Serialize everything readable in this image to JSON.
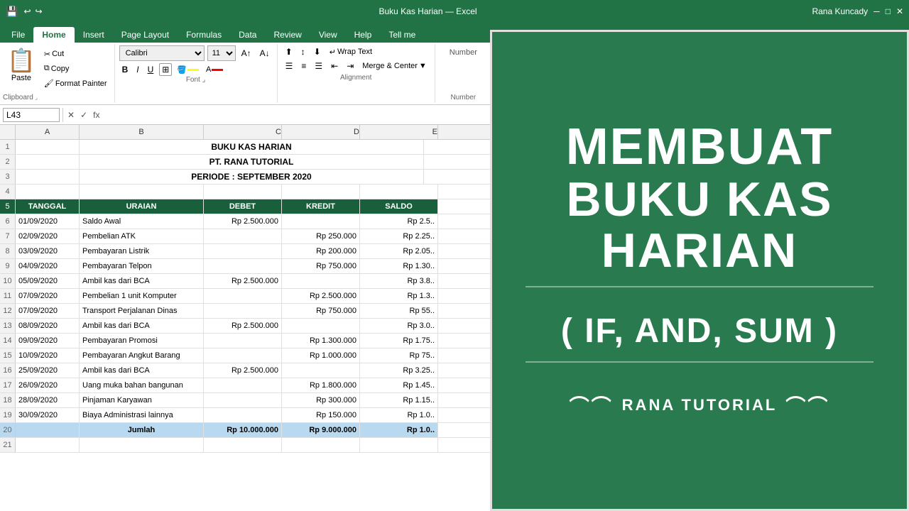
{
  "titlebar": {
    "title": "Buku Kas Harian — Excel",
    "user": "Rana Kuncady"
  },
  "ribbon": {
    "tabs": [
      "File",
      "Home",
      "Insert",
      "Page Layout",
      "Formulas",
      "Data",
      "Review",
      "View",
      "Help",
      "Tell me"
    ],
    "active_tab": "Home",
    "clipboard": {
      "paste_label": "Paste",
      "cut_label": "Cut",
      "copy_label": "Copy",
      "format_painter_label": "Format Painter"
    },
    "font": {
      "family": "Calibri",
      "size": "11",
      "bold": "B",
      "italic": "I",
      "underline": "U"
    },
    "alignment": {
      "wrap_text": "Wrap Text",
      "merge_center": "Merge & Center"
    }
  },
  "formula_bar": {
    "cell_ref": "L43",
    "formula": ""
  },
  "columns": [
    "A",
    "B",
    "C",
    "D",
    "E"
  ],
  "spreadsheet": {
    "rows": [
      {
        "num": "1",
        "cells": [
          "",
          "BUKU KAS HARIAN",
          "",
          "",
          ""
        ]
      },
      {
        "num": "2",
        "cells": [
          "",
          "PT. RANA TUTORIAL",
          "",
          "",
          ""
        ]
      },
      {
        "num": "3",
        "cells": [
          "",
          "PERIODE : SEPTEMBER 2020",
          "",
          "",
          ""
        ]
      },
      {
        "num": "4",
        "cells": [
          "",
          "",
          "",
          "",
          ""
        ]
      },
      {
        "num": "5",
        "cells": [
          "TANGGAL",
          "URAIAN",
          "DEBET",
          "KREDIT",
          "SALDO"
        ],
        "is_header": true
      },
      {
        "num": "6",
        "cells": [
          "01/09/2020",
          "Saldo Awal",
          "Rp   2.500.000",
          "",
          "Rp   2.5.."
        ]
      },
      {
        "num": "7",
        "cells": [
          "02/09/2020",
          "Pembelian ATK",
          "",
          "Rp   250.000",
          "Rp   2.25.."
        ]
      },
      {
        "num": "8",
        "cells": [
          "03/09/2020",
          "Pembayaran Listrik",
          "",
          "Rp   200.000",
          "Rp   2.05.."
        ]
      },
      {
        "num": "9",
        "cells": [
          "04/09/2020",
          "Pembayaran Telpon",
          "",
          "Rp   750.000",
          "Rp   1.30.."
        ]
      },
      {
        "num": "10",
        "cells": [
          "05/09/2020",
          "Ambil kas dari BCA",
          "Rp   2.500.000",
          "",
          "Rp   3.8.."
        ]
      },
      {
        "num": "11",
        "cells": [
          "07/09/2020",
          "Pembelian 1 unit Komputer",
          "",
          "Rp   2.500.000",
          "Rp   1.3.."
        ]
      },
      {
        "num": "12",
        "cells": [
          "07/09/2020",
          "Transport Perjalanan Dinas",
          "",
          "Rp   750.000",
          "Rp   55.."
        ]
      },
      {
        "num": "13",
        "cells": [
          "08/09/2020",
          "Ambil kas dari BCA",
          "Rp   2.500.000",
          "",
          "Rp   3.0.."
        ]
      },
      {
        "num": "14",
        "cells": [
          "09/09/2020",
          "Pembayaran Promosi",
          "",
          "Rp   1.300.000",
          "Rp   1.75.."
        ]
      },
      {
        "num": "15",
        "cells": [
          "10/09/2020",
          "Pembayaran Angkut Barang",
          "",
          "Rp   1.000.000",
          "Rp   75.."
        ]
      },
      {
        "num": "16",
        "cells": [
          "25/09/2020",
          "Ambil kas dari BCA",
          "Rp   2.500.000",
          "",
          "Rp   3.25.."
        ]
      },
      {
        "num": "17",
        "cells": [
          "26/09/2020",
          "Uang muka bahan bangunan",
          "",
          "Rp   1.800.000",
          "Rp   1.45.."
        ]
      },
      {
        "num": "18",
        "cells": [
          "28/09/2020",
          "Pinjaman Karyawan",
          "",
          "Rp   300.000",
          "Rp   1.15.."
        ]
      },
      {
        "num": "19",
        "cells": [
          "30/09/2020",
          "Biaya Administrasi lainnya",
          "",
          "Rp   150.000",
          "Rp   1.0.."
        ]
      },
      {
        "num": "20",
        "cells": [
          "",
          "Jumlah",
          "Rp   10.000.000",
          "Rp   9.000.000",
          "Rp   1.0.."
        ],
        "is_jumlah": true
      },
      {
        "num": "21",
        "cells": [
          "",
          "",
          "",
          "",
          ""
        ]
      }
    ]
  },
  "overlay": {
    "line1": "MEMBUAT",
    "line2": "BUKU KAS",
    "line3": "HARIAN",
    "formula_line": "( IF, AND, SUM )",
    "brand": "RANA TUTORIAL"
  }
}
